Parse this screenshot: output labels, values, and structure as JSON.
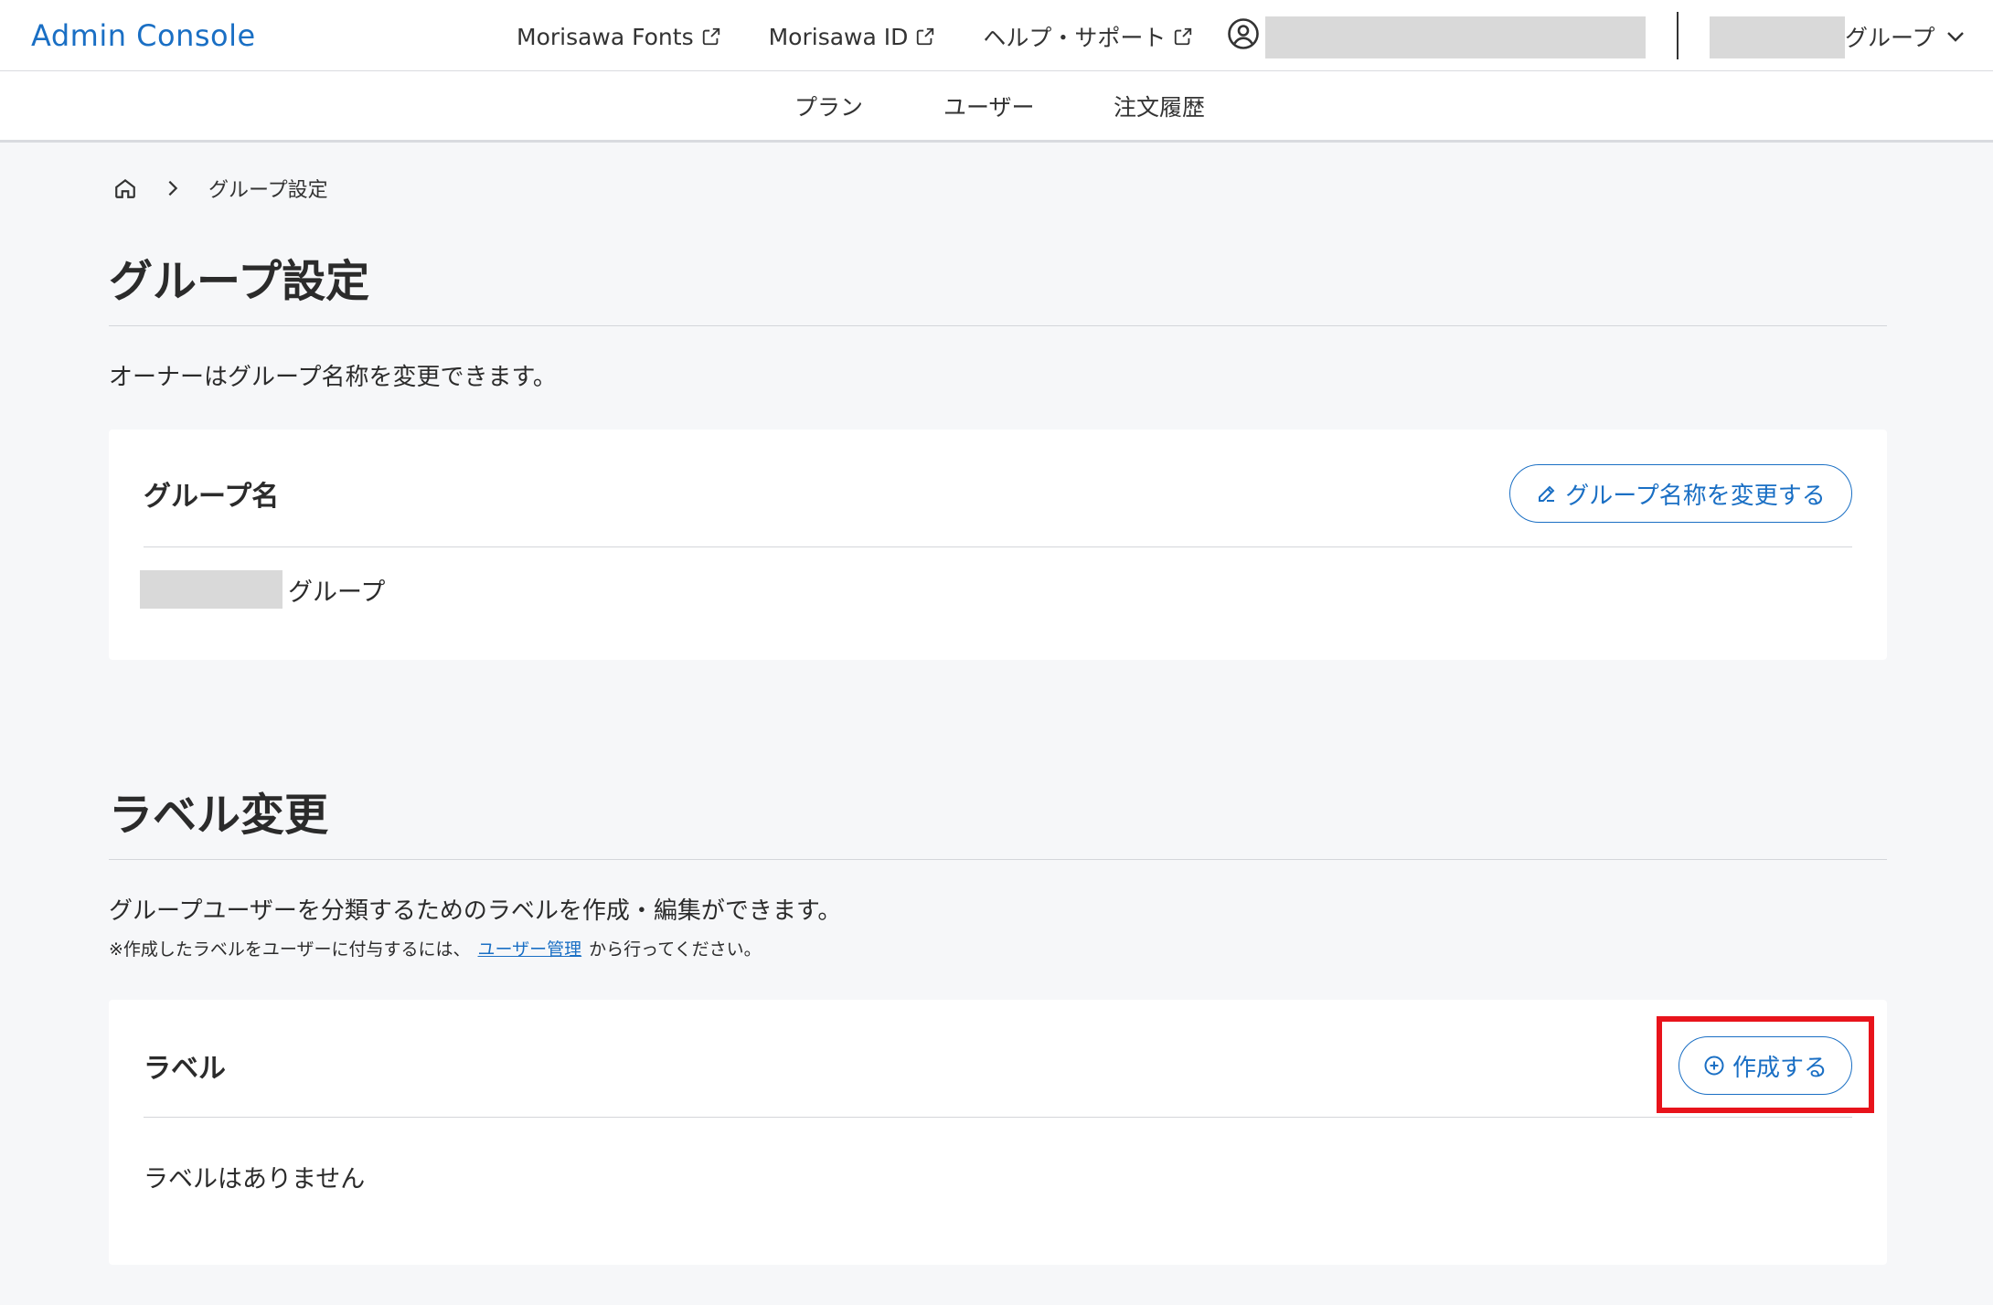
{
  "header": {
    "logo": "Admin Console",
    "links": [
      "Morisawa Fonts",
      "Morisawa ID",
      "ヘルプ・サポート"
    ],
    "group_switch_label": "グループ"
  },
  "subnav": {
    "items": [
      "プラン",
      "ユーザー",
      "注文履歴"
    ]
  },
  "breadcrumb": {
    "current": "グループ設定"
  },
  "group_settings": {
    "title": "グループ設定",
    "description": "オーナーはグループ名称を変更できます。",
    "card_title": "グループ名",
    "edit_button": "グループ名称を変更する",
    "group_name_suffix": "グループ"
  },
  "label_settings": {
    "title": "ラベル変更",
    "description": "グループユーザーを分類するためのラベルを作成・編集ができます。",
    "note_prefix": "※作成したラベルをユーザーに付与するには、",
    "note_link": "ユーザー管理",
    "note_suffix": "から行ってください。",
    "card_title": "ラベル",
    "create_button": "作成する",
    "empty_text": "ラベルはありません"
  },
  "colors": {
    "accent": "#1a6fc4",
    "highlight": "#e8131b",
    "page_bg": "#f6f7f9"
  }
}
